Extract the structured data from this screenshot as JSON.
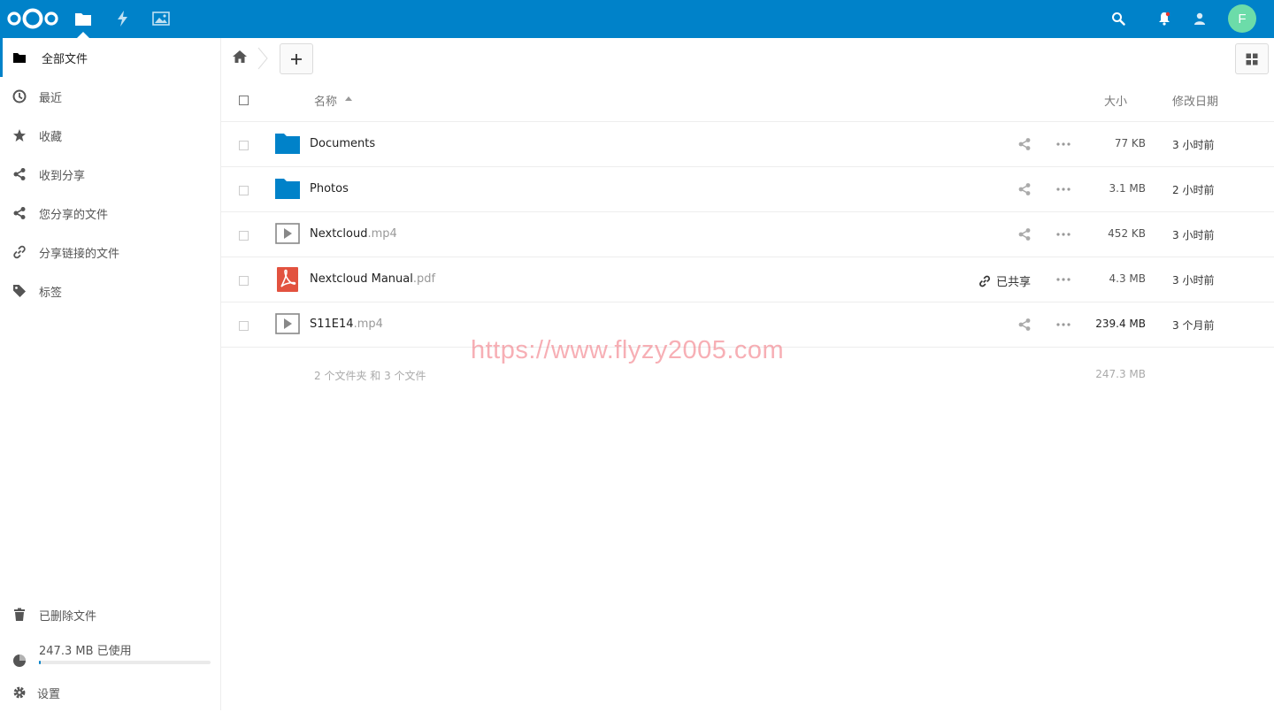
{
  "header": {
    "apps": [
      {
        "name": "files-icon"
      },
      {
        "name": "activity-icon"
      },
      {
        "name": "gallery-icon"
      }
    ],
    "avatar_letter": "F",
    "colors": {
      "brand": "#0082c9",
      "avatar": "#6cdca9",
      "pdf": "#e2523f"
    }
  },
  "sidebar": {
    "items": [
      {
        "label": "全部文件",
        "icon": "folder-icon"
      },
      {
        "label": "最近",
        "icon": "clock-icon"
      },
      {
        "label": "收藏",
        "icon": "star-icon"
      },
      {
        "label": "收到分享",
        "icon": "share-icon"
      },
      {
        "label": "您分享的文件",
        "icon": "share-icon"
      },
      {
        "label": "分享链接的文件",
        "icon": "link-icon"
      },
      {
        "label": "标签",
        "icon": "tag-icon"
      }
    ],
    "trash_label": "已删除文件",
    "quota_label": "247.3 MB 已使用",
    "quota_fraction": 0.01,
    "settings_label": "设置"
  },
  "table": {
    "headers": {
      "name": "名称",
      "size": "大小",
      "modified": "修改日期"
    },
    "rows": [
      {
        "base": "Documents",
        "ext": "",
        "type": "folder",
        "size": "77 KB",
        "modified": "3 小时前",
        "shared": ""
      },
      {
        "base": "Photos",
        "ext": "",
        "type": "folder",
        "size": "3.1 MB",
        "modified": "2 小时前",
        "shared": ""
      },
      {
        "base": "Nextcloud",
        "ext": ".mp4",
        "type": "video",
        "size": "452 KB",
        "modified": "3 小时前",
        "shared": ""
      },
      {
        "base": "Nextcloud Manual",
        "ext": ".pdf",
        "type": "pdf",
        "size": "4.3 MB",
        "modified": "3 小时前",
        "shared": "已共享"
      },
      {
        "base": "S11E14",
        "ext": ".mp4",
        "type": "video",
        "size": "239.4 MB",
        "modified": "3 个月前",
        "shared": ""
      }
    ],
    "summary_text": "2 个文件夹 和 3 个文件",
    "summary_size": "247.3 MB"
  },
  "watermark": "https://www.flyzy2005.com"
}
